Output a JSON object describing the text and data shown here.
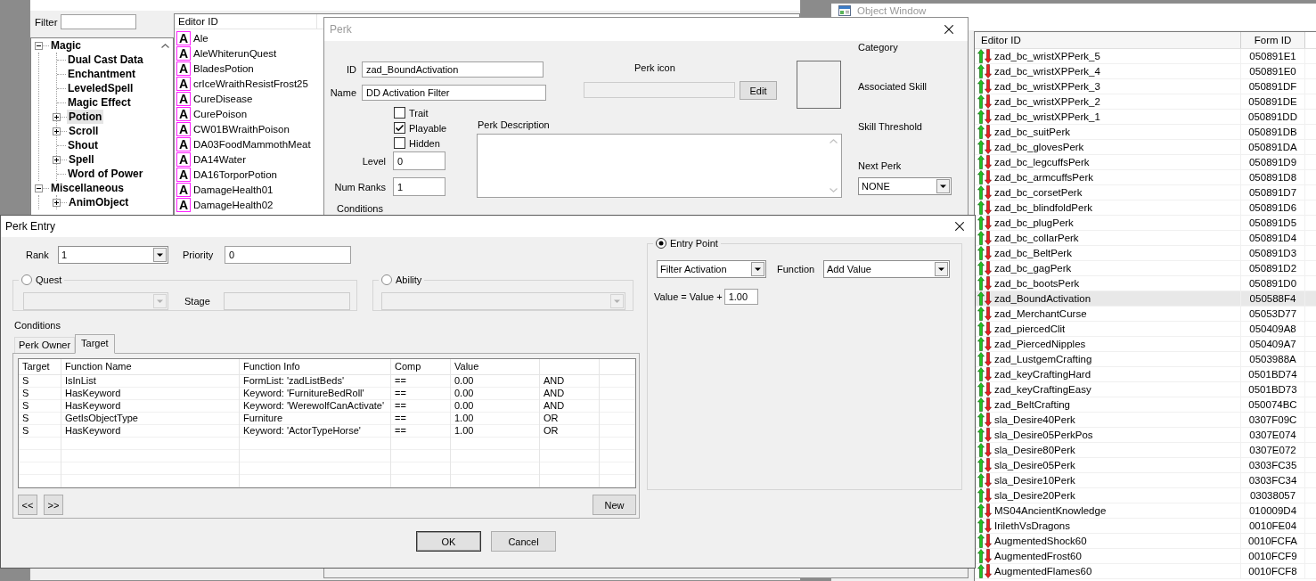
{
  "object_window_left": {
    "filter": {
      "label": "Filter"
    },
    "tree": [
      {
        "label": "Magic",
        "kind": "folder",
        "expanded": true,
        "selected": false,
        "children": [
          {
            "label": "Dual Cast Data",
            "kind": "leaf",
            "selected": false
          },
          {
            "label": "Enchantment",
            "kind": "leaf",
            "selected": false
          },
          {
            "label": "LeveledSpell",
            "kind": "leaf",
            "selected": false
          },
          {
            "label": "Magic Effect",
            "kind": "leaf",
            "selected": false
          },
          {
            "label": "Potion",
            "kind": "folder",
            "expanded": false,
            "selected": true
          },
          {
            "label": "Scroll",
            "kind": "folder",
            "expanded": false,
            "selected": false
          },
          {
            "label": "Shout",
            "kind": "leaf",
            "selected": false
          },
          {
            "label": "Spell",
            "kind": "folder",
            "expanded": false,
            "selected": false
          },
          {
            "label": "Word of Power",
            "kind": "leaf",
            "selected": false
          }
        ]
      },
      {
        "label": "Miscellaneous",
        "kind": "folder",
        "expanded": true,
        "selected": false,
        "children": [
          {
            "label": "AnimObject",
            "kind": "folder",
            "expanded": false,
            "selected": false
          }
        ]
      }
    ],
    "list": {
      "columns": [
        "Editor ID"
      ],
      "rows": [
        {
          "type_glyph": "A",
          "editor_id": "Ale"
        },
        {
          "type_glyph": "A",
          "editor_id": "AleWhiterunQuest"
        },
        {
          "type_glyph": "A",
          "editor_id": "BladesPotion"
        },
        {
          "type_glyph": "A",
          "editor_id": "crIceWraithResistFrost25"
        },
        {
          "type_glyph": "A",
          "editor_id": "CureDisease"
        },
        {
          "type_glyph": "A",
          "editor_id": "CurePoison"
        },
        {
          "type_glyph": "A",
          "editor_id": "CW01BWraithPoison"
        },
        {
          "type_glyph": "A",
          "editor_id": "DA03FoodMammothMeat"
        },
        {
          "type_glyph": "A",
          "editor_id": "DA14Water"
        },
        {
          "type_glyph": "A",
          "editor_id": "DA16TorporPotion"
        },
        {
          "type_glyph": "A",
          "editor_id": "DamageHealth01"
        },
        {
          "type_glyph": "A",
          "editor_id": "DamageHealth02"
        }
      ]
    }
  },
  "object_window_right": {
    "title": "Object Window",
    "active": false,
    "columns": [
      "Editor ID",
      "Form ID"
    ],
    "rows": [
      {
        "editor_id": "zad_bc_wristXPPerk_5",
        "form_id": "050891E1",
        "selected": false
      },
      {
        "editor_id": "zad_bc_wristXPPerk_4",
        "form_id": "050891E0",
        "selected": false
      },
      {
        "editor_id": "zad_bc_wristXPPerk_3",
        "form_id": "050891DF",
        "selected": false
      },
      {
        "editor_id": "zad_bc_wristXPPerk_2",
        "form_id": "050891DE",
        "selected": false
      },
      {
        "editor_id": "zad_bc_wristXPPerk_1",
        "form_id": "050891DD",
        "selected": false
      },
      {
        "editor_id": "zad_bc_suitPerk",
        "form_id": "050891DB",
        "selected": false
      },
      {
        "editor_id": "zad_bc_glovesPerk",
        "form_id": "050891DA",
        "selected": false
      },
      {
        "editor_id": "zad_bc_legcuffsPerk",
        "form_id": "050891D9",
        "selected": false
      },
      {
        "editor_id": "zad_bc_armcuffsPerk",
        "form_id": "050891D8",
        "selected": false
      },
      {
        "editor_id": "zad_bc_corsetPerk",
        "form_id": "050891D7",
        "selected": false
      },
      {
        "editor_id": "zad_bc_blindfoldPerk",
        "form_id": "050891D6",
        "selected": false
      },
      {
        "editor_id": "zad_bc_plugPerk",
        "form_id": "050891D5",
        "selected": false
      },
      {
        "editor_id": "zad_bc_collarPerk",
        "form_id": "050891D4",
        "selected": false
      },
      {
        "editor_id": "zad_bc_BeltPerk",
        "form_id": "050891D3",
        "selected": false
      },
      {
        "editor_id": "zad_bc_gagPerk",
        "form_id": "050891D2",
        "selected": false
      },
      {
        "editor_id": "zad_bc_bootsPerk",
        "form_id": "050891D0",
        "selected": false
      },
      {
        "editor_id": "zad_BoundActivation",
        "form_id": "050588F4",
        "selected": true
      },
      {
        "editor_id": "zad_MerchantCurse",
        "form_id": "05053D77",
        "selected": false
      },
      {
        "editor_id": "zad_piercedClit",
        "form_id": "050409A8",
        "selected": false
      },
      {
        "editor_id": "zad_PiercedNipples",
        "form_id": "050409A7",
        "selected": false
      },
      {
        "editor_id": "zad_LustgemCrafting",
        "form_id": "0503988A",
        "selected": false
      },
      {
        "editor_id": "zad_keyCraftingHard",
        "form_id": "0501BD74",
        "selected": false
      },
      {
        "editor_id": "zad_keyCraftingEasy",
        "form_id": "0501BD73",
        "selected": false
      },
      {
        "editor_id": "zad_BeltCrafting",
        "form_id": "050074BC",
        "selected": false
      },
      {
        "editor_id": "sla_Desire40Perk",
        "form_id": "0307F09C",
        "selected": false
      },
      {
        "editor_id": "sla_Desire05PerkPos",
        "form_id": "0307E074",
        "selected": false
      },
      {
        "editor_id": "sla_Desire80Perk",
        "form_id": "0307E072",
        "selected": false
      },
      {
        "editor_id": "sla_Desire05Perk",
        "form_id": "0303FC35",
        "selected": false
      },
      {
        "editor_id": "sla_Desire10Perk",
        "form_id": "0303FC34",
        "selected": false
      },
      {
        "editor_id": "sla_Desire20Perk",
        "form_id": "03038057",
        "selected": false
      },
      {
        "editor_id": "MS04AncientKnowledge",
        "form_id": "010009D4",
        "selected": false
      },
      {
        "editor_id": "IrilethVsDragons",
        "form_id": "0010FE04",
        "selected": false
      },
      {
        "editor_id": "AugmentedShock60",
        "form_id": "0010FCFA",
        "selected": false
      },
      {
        "editor_id": "AugmentedFrost60",
        "form_id": "0010FCF9",
        "selected": false
      },
      {
        "editor_id": "AugmentedFlames60",
        "form_id": "0010FCF8",
        "selected": false
      }
    ]
  },
  "perk_window": {
    "title": "Perk",
    "active": false,
    "id": {
      "label": "ID",
      "value": "zad_BoundActivation"
    },
    "name": {
      "label": "Name",
      "value": "DD Activation Filter"
    },
    "flags": [
      {
        "label": "Trait",
        "checked": false
      },
      {
        "label": "Playable",
        "checked": true
      },
      {
        "label": "Hidden",
        "checked": false
      }
    ],
    "level": {
      "label": "Level",
      "value": "0"
    },
    "num_ranks": {
      "label": "Num Ranks",
      "value": "1"
    },
    "perk_icon": {
      "label": "Perk icon",
      "button": "Edit",
      "disabled": true
    },
    "description": {
      "label": "Perk Description"
    },
    "category": {
      "label": "Category"
    },
    "associated_skill": {
      "label": "Associated Skill"
    },
    "skill_threshold": {
      "label": "Skill Threshold"
    },
    "next_perk": {
      "label": "Next Perk",
      "value": "NONE"
    },
    "conditions_label": "Conditions"
  },
  "perk_entry_window": {
    "title": "Perk Entry",
    "active": true,
    "rank": {
      "label": "Rank",
      "value": "1"
    },
    "priority": {
      "label": "Priority",
      "value": "0"
    },
    "entry_types": [
      {
        "kind": "quest",
        "label": "Quest",
        "selected": false,
        "stage_label": "Stage"
      },
      {
        "kind": "ability",
        "label": "Ability",
        "selected": false
      },
      {
        "kind": "entry_point",
        "label": "Entry Point",
        "selected": true,
        "entry_point": "Filter Activation",
        "function_label": "Function",
        "function": "Add Value",
        "formula_label": "Value = Value +",
        "formula_value": "1.00"
      }
    ],
    "conditions": {
      "label": "Conditions",
      "tabs": [
        {
          "label": "Perk Owner",
          "selected": false
        },
        {
          "label": "Target",
          "selected": true
        }
      ],
      "columns": [
        "Target",
        "Function Name",
        "Function Info",
        "Comp",
        "Value"
      ],
      "rows": [
        {
          "target": "S",
          "function_name": "IsInList",
          "function_info": "FormList: 'zadListBeds'",
          "comp": "==",
          "value": "0.00",
          "column_6": "AND"
        },
        {
          "target": "S",
          "function_name": "HasKeyword",
          "function_info": "Keyword: 'FurnitureBedRoll'",
          "comp": "==",
          "value": "0.00",
          "column_6": "AND"
        },
        {
          "target": "S",
          "function_name": "HasKeyword",
          "function_info": "Keyword: 'WerewolfCanActivate'",
          "comp": "==",
          "value": "0.00",
          "column_6": "AND"
        },
        {
          "target": "S",
          "function_name": "GetIsObjectType",
          "function_info": "Furniture",
          "comp": "==",
          "value": "1.00",
          "column_6": "OR"
        },
        {
          "target": "S",
          "function_name": "HasKeyword",
          "function_info": "Keyword: 'ActorTypeHorse'",
          "comp": "==",
          "value": "1.00",
          "column_6": "OR"
        }
      ],
      "buttons": [
        {
          "kind": "prev",
          "label": "<<"
        },
        {
          "kind": "next",
          "label": ">>"
        },
        {
          "kind": "new",
          "label": "New"
        }
      ]
    },
    "buttons": [
      {
        "label": "OK",
        "default": true
      },
      {
        "label": "Cancel",
        "default": false
      }
    ]
  }
}
